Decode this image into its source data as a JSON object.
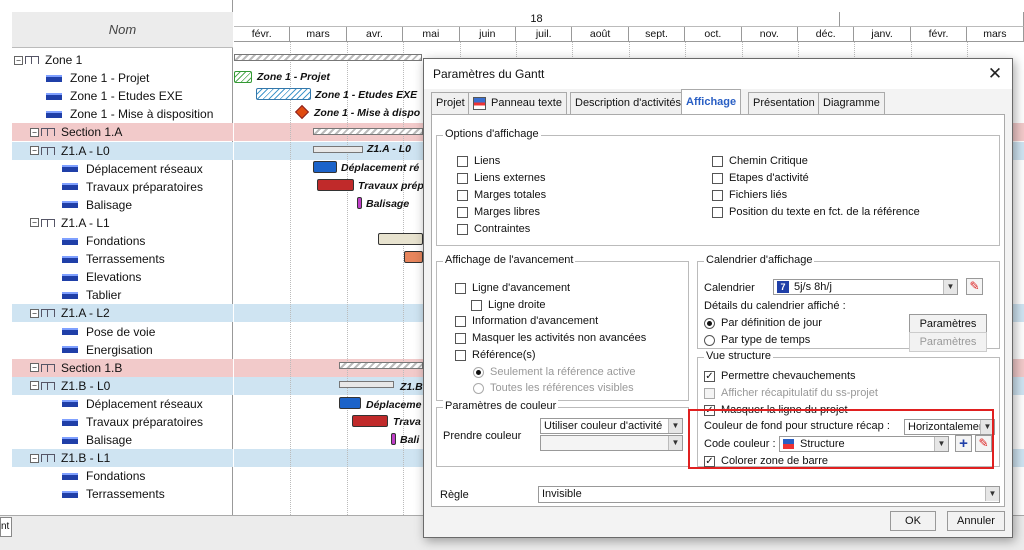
{
  "tree": {
    "header": "Nom",
    "rows": [
      {
        "label": "Zone 1",
        "kind": "group",
        "indent": 0
      },
      {
        "label": "Zone 1 - Projet",
        "kind": "task",
        "indent": 1
      },
      {
        "label": "Zone 1 - Etudes EXE",
        "kind": "task",
        "indent": 1
      },
      {
        "label": "Zone 1 - Mise à disposition",
        "kind": "task",
        "indent": 1
      },
      {
        "label": "Section 1.A",
        "kind": "section",
        "indent": 1
      },
      {
        "label": "Z1.A - L0",
        "kind": "sub",
        "indent": 2
      },
      {
        "label": "Déplacement réseaux",
        "kind": "task",
        "indent": 3
      },
      {
        "label": "Travaux préparatoires",
        "kind": "task",
        "indent": 3
      },
      {
        "label": "Balisage",
        "kind": "task",
        "indent": 3
      },
      {
        "label": "Z1.A - L1",
        "kind": "group",
        "indent": 2
      },
      {
        "label": "Fondations",
        "kind": "task",
        "indent": 3
      },
      {
        "label": "Terrassements",
        "kind": "task",
        "indent": 3
      },
      {
        "label": "Elevations",
        "kind": "task",
        "indent": 3
      },
      {
        "label": "Tablier",
        "kind": "task",
        "indent": 3
      },
      {
        "label": "Z1.A - L2",
        "kind": "sub",
        "indent": 2
      },
      {
        "label": "Pose de voie",
        "kind": "task",
        "indent": 3
      },
      {
        "label": "Energisation",
        "kind": "task",
        "indent": 3
      },
      {
        "label": "Section 1.B",
        "kind": "section",
        "indent": 1
      },
      {
        "label": "Z1.B - L0",
        "kind": "sub",
        "indent": 2
      },
      {
        "label": "Déplacement réseaux",
        "kind": "task",
        "indent": 3
      },
      {
        "label": "Travaux préparatoires",
        "kind": "task",
        "indent": 3
      },
      {
        "label": "Balisage",
        "kind": "task",
        "indent": 3
      },
      {
        "label": "Z1.B - L1",
        "kind": "sub",
        "indent": 2
      },
      {
        "label": "Fondations",
        "kind": "task",
        "indent": 3
      },
      {
        "label": "Terrassements",
        "kind": "task",
        "indent": 3
      }
    ]
  },
  "timeline": {
    "year": "18",
    "months": [
      "févr.",
      "mars",
      "avr.",
      "mai",
      "juin",
      "juil.",
      "août",
      "sept.",
      "oct.",
      "nov.",
      "déc.",
      "janv.",
      "févr.",
      "mars"
    ]
  },
  "gantt_bars": [
    {
      "row": 1,
      "label": "Zone 1 - Projet"
    },
    {
      "row": 2,
      "label": "Zone 1 - Etudes EXE"
    },
    {
      "row": 3,
      "label": "Zone 1 - Mise à dispo"
    },
    {
      "row": 5,
      "label": "Z1.A - L0"
    },
    {
      "row": 6,
      "label": "Déplacement ré"
    },
    {
      "row": 7,
      "label": "Travaux prépa"
    },
    {
      "row": 8,
      "label": "Balisage"
    },
    {
      "row": 18,
      "label": "Z1.B"
    },
    {
      "row": 19,
      "label": "Déplaceme"
    },
    {
      "row": 20,
      "label": "Trava"
    },
    {
      "row": 21,
      "label": "Bali"
    }
  ],
  "bottom_tab": "nt",
  "dialog": {
    "title": "Paramètres du Gantt",
    "tabs": [
      "Projet",
      "Panneau texte",
      "Description d'activités",
      "Affichage",
      "Présentation",
      "Diagramme"
    ],
    "active_tab": "Affichage",
    "options_affichage": {
      "legend": "Options d'affichage",
      "left": [
        "Liens",
        "Liens externes",
        "Marges totales",
        "Marges libres",
        "Contraintes"
      ],
      "right": [
        "Chemin Critique",
        "Etapes d'activité",
        "Fichiers liés",
        "Position du texte en fct. de la référence"
      ]
    },
    "avancement": {
      "legend": "Affichage de l'avancement",
      "ligne_avancement": "Ligne d'avancement",
      "ligne_droite": "Ligne droite",
      "information": "Information d'avancement",
      "masquer": "Masquer les activités non avancées",
      "references": "Référence(s)",
      "radio_active": "Seulement la référence active",
      "radio_toutes": "Toutes les références visibles"
    },
    "calendrier": {
      "legend": "Calendrier d'affichage",
      "label": "Calendrier",
      "value": "5j/s 8h/j",
      "details": "Détails du calendrier affiché :",
      "radio_jour": "Par définition de jour",
      "radio_type": "Par type de temps",
      "btn_params": "Paramètres",
      "btn_params_dis": "Paramètres"
    },
    "vue_structure": {
      "legend": "Vue structure",
      "permettre": "Permettre chevauchements",
      "afficher": "Afficher récapitulatif du ss-projet",
      "masquer": "Masquer la ligne du projet",
      "couleur_label": "Couleur de fond pour structure récap :",
      "couleur_value": "Horizontalemen",
      "code_label": "Code couleur :",
      "code_value": "Structure",
      "colorer": "Colorer zone de barre"
    },
    "couleur": {
      "legend": "Paramètres de couleur",
      "prendre": "Prendre couleur",
      "value": "Utiliser couleur d'activité",
      "value2": ""
    },
    "regle": {
      "label": "Règle",
      "value": "Invisible"
    },
    "ok": "OK",
    "cancel": "Annuler"
  },
  "colors": {
    "highlight_border": "#e02020",
    "active_tab": "#2a5fc4",
    "section_bg": "#f2caca",
    "sub_bg": "#cfe4f2",
    "task_icon": "#1f3fa8"
  }
}
